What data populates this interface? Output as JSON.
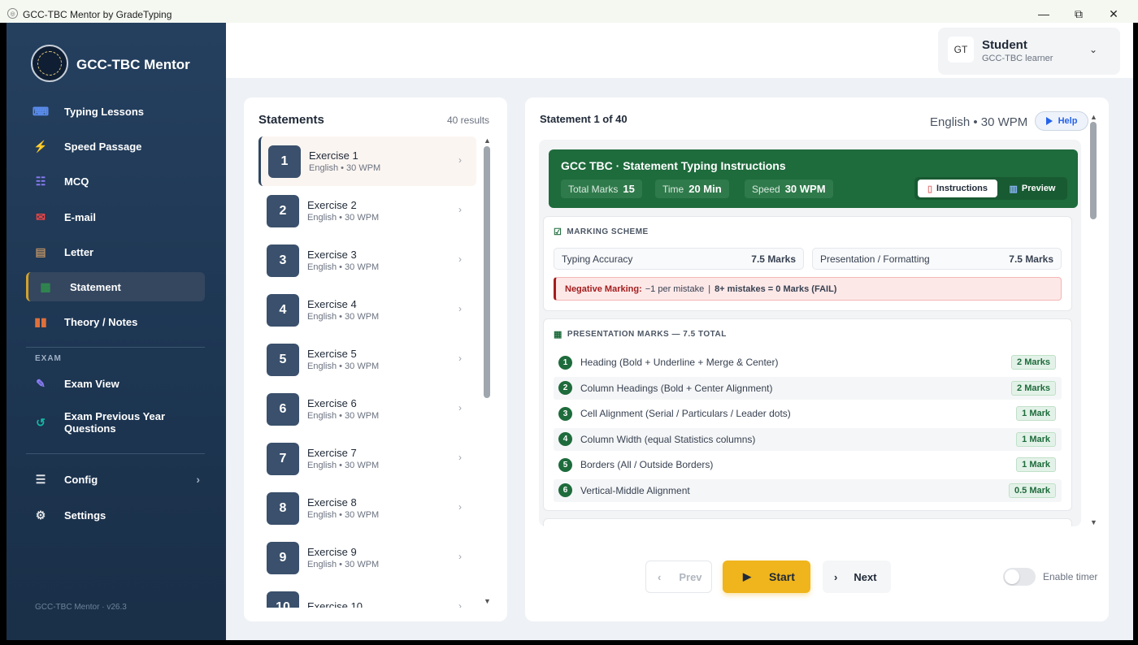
{
  "window": {
    "title": "GCC-TBC Mentor by GradeTyping",
    "controls": {
      "minimize": "—",
      "maximize": "⧉",
      "close": "✕"
    }
  },
  "sidebar": {
    "brand": "GCC-TBC Mentor",
    "items": [
      {
        "label": "Typing Lessons",
        "icon": "keyboard-icon",
        "glyph": "⌨",
        "color": "#5b8def"
      },
      {
        "label": "Speed Passage",
        "icon": "lightning-icon",
        "glyph": "⚡",
        "color": "#f5b71f"
      },
      {
        "label": "MCQ",
        "icon": "checklist-icon",
        "glyph": "☷",
        "color": "#8b7cf6"
      },
      {
        "label": "E-mail",
        "icon": "envelope-icon",
        "glyph": "✉",
        "color": "#ef4444"
      },
      {
        "label": "Letter",
        "icon": "document-icon",
        "glyph": "▤",
        "color": "#b08a63"
      },
      {
        "label": "Statement",
        "icon": "statement-icon",
        "glyph": "▦",
        "color": "#2f8a4d"
      },
      {
        "label": "Theory / Notes",
        "icon": "book-icon",
        "glyph": "▮▮",
        "color": "#e0703a"
      }
    ],
    "exam_label": "EXAM",
    "exam_items": [
      {
        "label": "Exam View",
        "icon": "pencil-icon",
        "glyph": "✎",
        "color": "#8b7cf6"
      },
      {
        "label": "Exam Previous Year Questions",
        "icon": "history-icon",
        "glyph": "↺",
        "color": "#14b8a6"
      }
    ],
    "footer_items": [
      {
        "label": "Config",
        "icon": "sliders-icon",
        "glyph": "☰",
        "color": "#e5e7eb"
      },
      {
        "label": "Settings",
        "icon": "gear-icon",
        "glyph": "⚙",
        "color": "#e5e7eb"
      }
    ],
    "version": "GCC-TBC Mentor · v26.3"
  },
  "profile": {
    "initials": "GT",
    "name": "Student",
    "role": "GCC-TBC learner"
  },
  "list": {
    "title": "Statements",
    "count": "40 results",
    "items": [
      {
        "num": "1",
        "title": "Exercise 1",
        "meta": "English • 30 WPM"
      },
      {
        "num": "2",
        "title": "Exercise 2",
        "meta": "English • 30 WPM"
      },
      {
        "num": "3",
        "title": "Exercise 3",
        "meta": "English • 30 WPM"
      },
      {
        "num": "4",
        "title": "Exercise 4",
        "meta": "English • 30 WPM"
      },
      {
        "num": "5",
        "title": "Exercise 5",
        "meta": "English • 30 WPM"
      },
      {
        "num": "6",
        "title": "Exercise 6",
        "meta": "English • 30 WPM"
      },
      {
        "num": "7",
        "title": "Exercise 7",
        "meta": "English • 30 WPM"
      },
      {
        "num": "8",
        "title": "Exercise 8",
        "meta": "English • 30 WPM"
      },
      {
        "num": "9",
        "title": "Exercise 9",
        "meta": "English • 30 WPM"
      },
      {
        "num": "10",
        "title": "Exercise 10",
        "meta": ""
      }
    ]
  },
  "detail": {
    "title": "Statement 1 of 40",
    "meta": "English • 30 WPM",
    "help": "Help",
    "banner": {
      "title": "GCC TBC · Statement Typing Instructions",
      "chips": [
        {
          "label": "Total Marks",
          "value": "15"
        },
        {
          "label": "Time",
          "value": "20 Min"
        },
        {
          "label": "Speed",
          "value": "30 WPM"
        }
      ],
      "tabs": {
        "instructions": "Instructions",
        "preview": "Preview"
      }
    },
    "marking": {
      "heading": "MARKING SCHEME",
      "accuracy_label": "Typing Accuracy",
      "accuracy_value": "7.5 Marks",
      "presentation_label": "Presentation / Formatting",
      "presentation_value": "7.5 Marks",
      "negative_label": "Negative Marking:",
      "negative_text": "−1 per mistake",
      "negative_sep": "|",
      "negative_fail": "8+ mistakes = 0 Marks (FAIL)"
    },
    "presentation": {
      "heading": "PRESENTATION MARKS — 7.5 TOTAL",
      "rows": [
        {
          "n": "1",
          "text": "Heading (Bold + Underline + Merge & Center)",
          "marks": "2 Marks"
        },
        {
          "n": "2",
          "text": "Column Headings (Bold + Center Alignment)",
          "marks": "2 Marks"
        },
        {
          "n": "3",
          "text": "Cell Alignment (Serial / Particulars / Leader dots)",
          "marks": "1 Mark"
        },
        {
          "n": "4",
          "text": "Column Width (equal Statistics columns)",
          "marks": "1 Mark"
        },
        {
          "n": "5",
          "text": "Borders (All / Outside Borders)",
          "marks": "1 Mark"
        },
        {
          "n": "6",
          "text": "Vertical-Middle Alignment",
          "marks": "0.5 Mark"
        }
      ]
    },
    "buttons": {
      "prev": "Prev",
      "start": "Start",
      "next": "Next"
    },
    "timer": {
      "label": "Enable timer",
      "enabled": false
    }
  }
}
